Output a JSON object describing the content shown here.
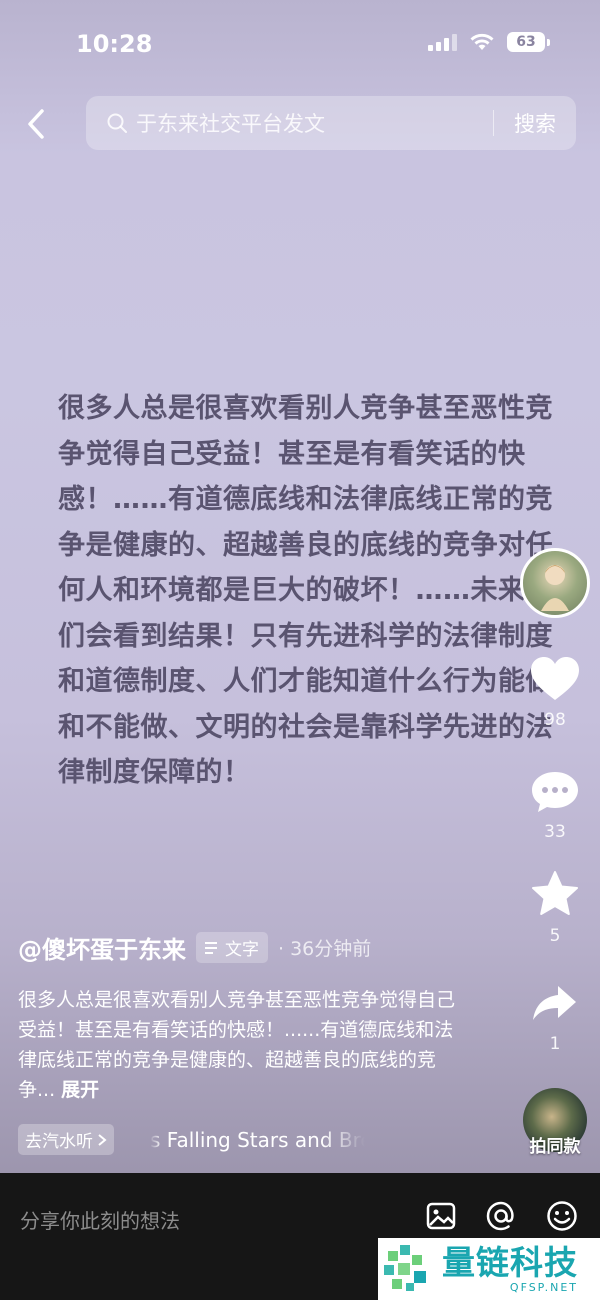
{
  "status_bar": {
    "time": "10:28",
    "battery": "63"
  },
  "search": {
    "query": "于东来社交平台发文",
    "button_label": "搜索"
  },
  "post": {
    "body": "很多人总是很喜欢看别人竞争甚至恶性竞争觉得自己受益！甚至是有看笑话的快感！……有道德底线和法律底线正常的竞争是健康的、超越善良的底线的竞争对任何人和环境都是巨大的破坏！……未来人们会看到结果！只有先进科学的法律制度和道德制度、人们才能知道什么行为能做和不能做、文明的社会是靠科学先进的法律制度保障的！"
  },
  "side_rail": {
    "likes": "98",
    "comments": "33",
    "favorites": "5",
    "shares": "1",
    "icons": [
      "avatar",
      "heart-icon",
      "comment-icon",
      "star-icon",
      "share-icon"
    ]
  },
  "author": {
    "name": "@傻坏蛋于东来",
    "type_badge": "文字",
    "time": "· 36分钟前"
  },
  "caption": {
    "text": "很多人总是很喜欢看别人竞争甚至恶性竞争觉得自己受益！甚至是有看笑话的快感！......有道德底线和法律底线正常的竞争是健康的、超越善良的底线的竞争...",
    "expand_label": "展开"
  },
  "music": {
    "chip_label": "去汽水听",
    "title": "s    Falling Stars and Bre"
  },
  "same_style": {
    "label": "拍同款"
  },
  "bottom_bar": {
    "placeholder": "分享你此刻的想法"
  },
  "watermark": {
    "brand": "量链科技",
    "domain": "QFSP.NET"
  },
  "colors": {
    "body_text": "#5a5470",
    "bottom_bar": "#161616",
    "watermark_brand": "#1aa6b0"
  }
}
